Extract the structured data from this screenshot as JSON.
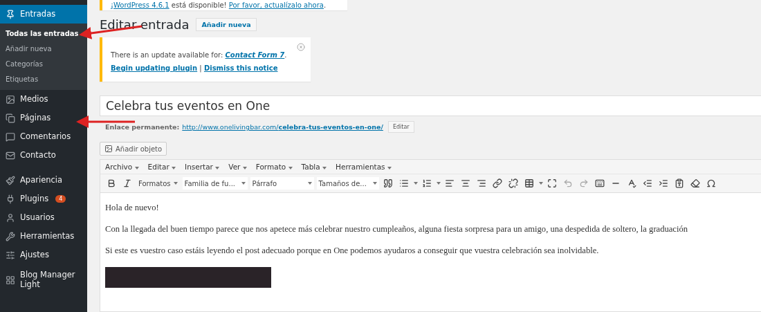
{
  "sidebar": {
    "items": [
      {
        "label": "Entradas",
        "selected": true,
        "children": [
          {
            "label": "Todas las entradas",
            "selected": true
          },
          {
            "label": "Añadir nueva",
            "selected": false
          },
          {
            "label": "Categorías",
            "selected": false
          },
          {
            "label": "Etiquetas",
            "selected": false
          }
        ]
      },
      {
        "label": "Medios",
        "selected": false
      },
      {
        "label": "Páginas",
        "selected": false
      },
      {
        "label": "Comentarios",
        "selected": false
      },
      {
        "label": "Contacto",
        "selected": false
      },
      {
        "label": "Apariencia",
        "selected": false
      },
      {
        "label": "Plugins",
        "selected": false,
        "badge": "4"
      },
      {
        "label": "Usuarios",
        "selected": false
      },
      {
        "label": "Herramientas",
        "selected": false
      },
      {
        "label": "Ajustes",
        "selected": false
      },
      {
        "label": "Blog Manager Light",
        "selected": false
      }
    ]
  },
  "core_notice": {
    "link_1": "¡WordPress 4.6.1",
    "text": " está disponible! ",
    "link_2": "Por favor, actualízalo ahora",
    "end": "."
  },
  "heading": {
    "title": "Editar entrada",
    "button": "Añadir nueva"
  },
  "update_notice": {
    "text_before": "There is an update available for: ",
    "plugin_link": "Contact Form 7",
    "text_after": ".",
    "action_1": "Begin updating plugin",
    "separator": "|",
    "action_2": "Dismiss this notice"
  },
  "post": {
    "title": "Celebra tus eventos en One",
    "permalink_label": "Enlace permanente:",
    "permalink_base": "http://www.onelivingbar.com/",
    "permalink_slug": "celebra-tus-eventos-en-one/",
    "edit_button": "Editar",
    "add_media": "Añadir objeto"
  },
  "menubar": [
    "Archivo",
    "Editar",
    "Insertar",
    "Ver",
    "Formato",
    "Tabla",
    "Herramientas"
  ],
  "toolbar": {
    "formats": "Formatos",
    "font_family": "Familia de fu...",
    "block": "Párrafo",
    "font_size": "Tamaños de..."
  },
  "content": [
    "Hola de nuevo!",
    "Con la llegada del buen tiempo parece que nos apetece más celebrar nuestro cumpleaños, alguna fiesta sorpresa para un amigo, una despedida de soltero, la graduación",
    "Si este es vuestro caso estáis leyendo el post adecuado porque en One podemos ayudaros a conseguir que vuestra celebración sea inolvidable."
  ]
}
